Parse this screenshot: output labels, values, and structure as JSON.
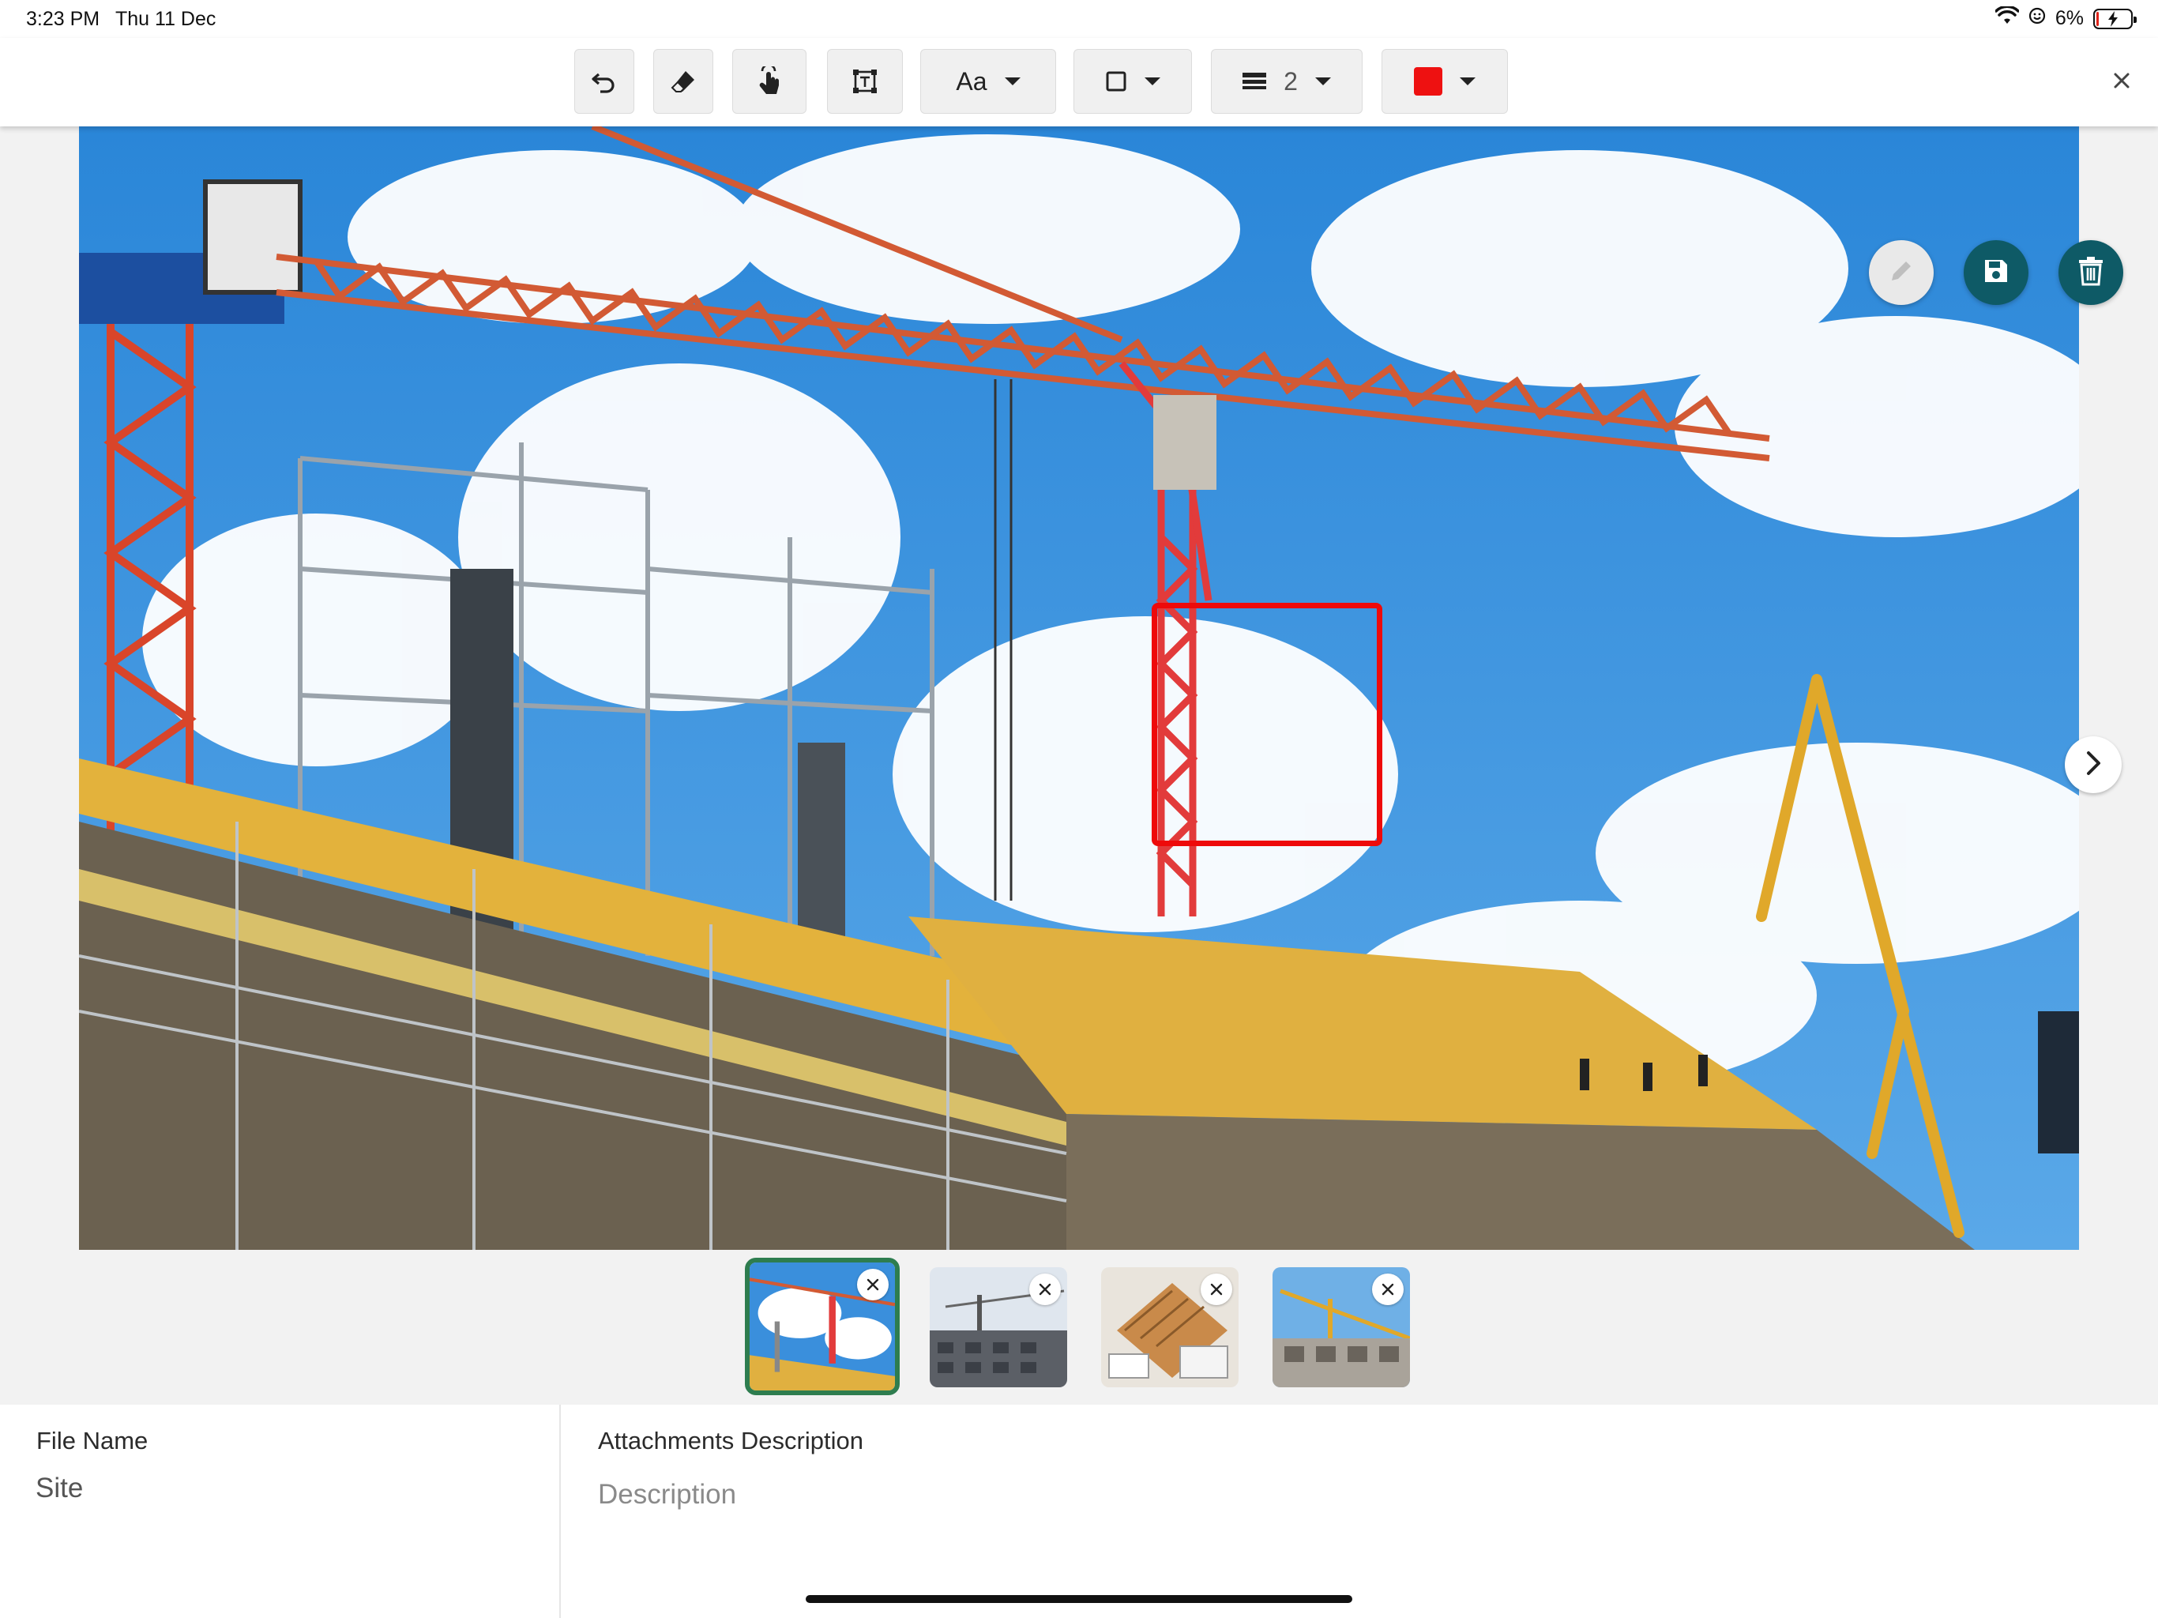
{
  "status_bar": {
    "time": "3:23 PM",
    "date": "Thu 11 Dec",
    "battery": "6%",
    "battery_level": 0.06,
    "icons": [
      "wifi-icon",
      "focus-icon",
      "battery-charging-icon"
    ]
  },
  "toolbar": {
    "tools": [
      {
        "name": "undo",
        "icon": "undo-icon"
      },
      {
        "name": "eraser",
        "icon": "eraser-icon"
      },
      {
        "name": "pan",
        "icon": "hand-pointer-icon"
      },
      {
        "name": "text-box",
        "icon": "text-frame-icon"
      }
    ],
    "font_label": "Aa",
    "shape_icon": "square-outline-icon",
    "stroke_width": "2",
    "color_hex": "#ee1111",
    "close_icon": "close-icon"
  },
  "photo": {
    "subject": "construction site with tower crane",
    "annotation_color": "#ee0a0a",
    "actions": [
      "edit-icon",
      "save-icon",
      "trash-icon"
    ],
    "next_icon": "chevron-right-icon"
  },
  "thumbnails": {
    "selected_index": 0,
    "items": [
      {
        "remove_icon": "close-icon"
      },
      {
        "remove_icon": "close-icon"
      },
      {
        "remove_icon": "close-icon"
      },
      {
        "remove_icon": "close-icon"
      }
    ]
  },
  "form": {
    "file_name_label": "File Name",
    "file_name_value": "Site",
    "description_label": "Attachments Description",
    "description_placeholder": "Description"
  },
  "colors": {
    "accent_teal": "#0e5a66",
    "selected_border": "#2e7d4f"
  }
}
